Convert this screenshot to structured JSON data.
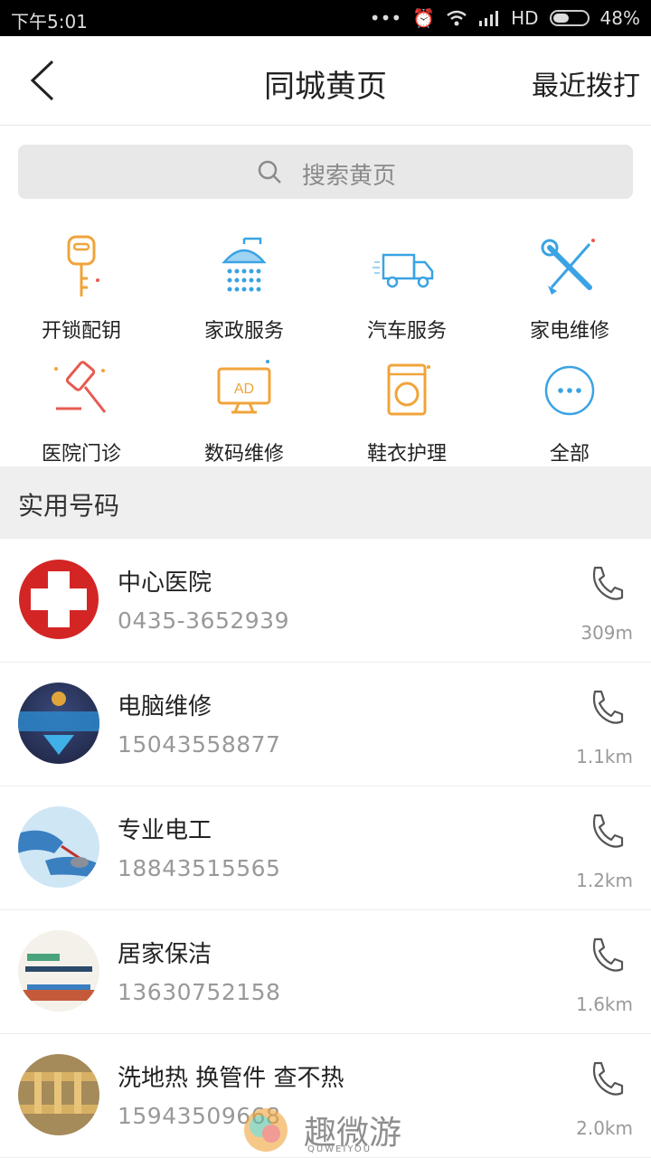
{
  "status_bar": {
    "time": "下午5:01",
    "network": "HD",
    "battery": "48%"
  },
  "header": {
    "title": "同城黄页",
    "recent_label": "最近拨打"
  },
  "search": {
    "placeholder": "搜索黄页"
  },
  "categories": [
    {
      "label": "开锁配钥",
      "icon": "key-icon",
      "color": "#f0a43a"
    },
    {
      "label": "家政服务",
      "icon": "shower-icon",
      "color": "#3aa3e3"
    },
    {
      "label": "汽车服务",
      "icon": "truck-icon",
      "color": "#3aa3e3"
    },
    {
      "label": "家电维修",
      "icon": "tools-icon",
      "color": "#3aa3e3"
    },
    {
      "label": "医院门诊",
      "icon": "gavel-icon",
      "color": "#e85a4f"
    },
    {
      "label": "数码维修",
      "icon": "monitor-ad-icon",
      "color": "#f0a43a"
    },
    {
      "label": "鞋衣护理",
      "icon": "washing-machine-icon",
      "color": "#f0a43a"
    },
    {
      "label": "全部",
      "icon": "more-icon",
      "color": "#3aa3e3"
    }
  ],
  "section_title": "实用号码",
  "contacts": [
    {
      "name": "中心医院",
      "phone": "0435-3652939",
      "distance": "309m"
    },
    {
      "name": "电脑维修",
      "phone": "15043558877",
      "distance": "1.1km"
    },
    {
      "name": "专业电工",
      "phone": "18843515565",
      "distance": "1.2km"
    },
    {
      "name": "居家保洁",
      "phone": "13630752158",
      "distance": "1.6km"
    },
    {
      "name": "洗地热 换管件 查不热",
      "phone": "15943509668",
      "distance": "2.0km"
    }
  ],
  "watermark": {
    "text": "趣微游",
    "sub": "QUWEIYOU"
  }
}
